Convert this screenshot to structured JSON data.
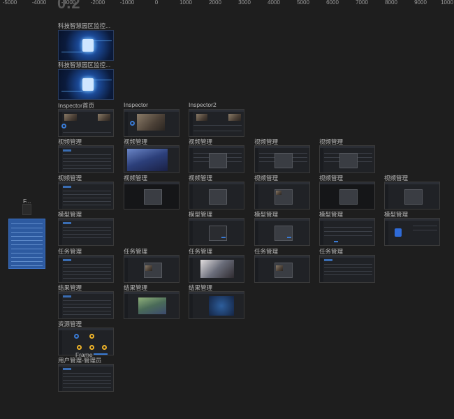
{
  "ruler": {
    "ticks": [
      "-5000",
      "-4000",
      "-3000",
      "-2000",
      "-1000",
      "0",
      "1000",
      "2000",
      "3000",
      "4000",
      "5000",
      "6000",
      "7000",
      "8000",
      "9000",
      "1000"
    ]
  },
  "canvas": {
    "page_title": "0.2",
    "side_frame_label": "F...",
    "frame_overlay_label": "Frame",
    "frames": {
      "hero1": "科技智慧园区监控...",
      "hero2": "科技智慧园区监控...",
      "inspector_home": "Inspector首页",
      "inspector": "Inspector",
      "inspector2": "Inspector2",
      "video": "视频管理",
      "model": "模型管理",
      "task": "任务管理",
      "result": "结果管理",
      "resource": "资源管理",
      "user_admin": "用户管理-管理员"
    }
  },
  "colors": {
    "background": "#1e1e1e",
    "frame_bg": "#202226",
    "accent_blue": "#3a7bd5",
    "side_frame_blue": "#2d5aa0",
    "ring_yellow": "#f0b429"
  }
}
